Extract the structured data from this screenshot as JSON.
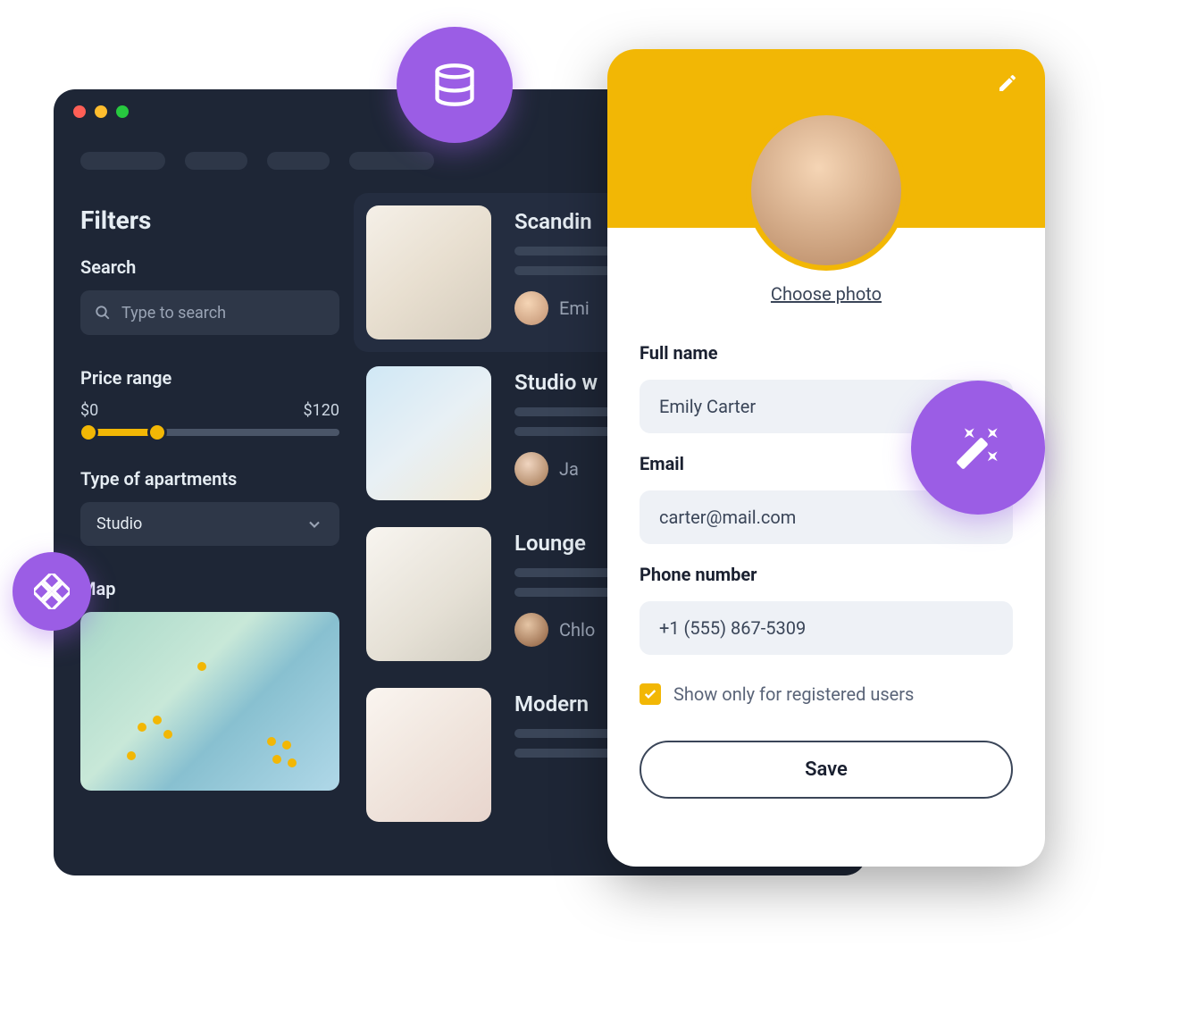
{
  "filters": {
    "heading": "Filters",
    "search_label": "Search",
    "search_placeholder": "Type to search",
    "price_label": "Price range",
    "price_min": "$0",
    "price_max": "$120",
    "type_label": "Type of apartments",
    "type_value": "Studio",
    "map_label": "Map"
  },
  "listings": [
    {
      "title": "Scandin",
      "owner": "Emi"
    },
    {
      "title": "Studio w",
      "owner": "Ja"
    },
    {
      "title": "Lounge",
      "owner": "Chlo"
    },
    {
      "title": "Modern",
      "owner": ""
    }
  ],
  "profile": {
    "choose_photo": "Choose photo",
    "full_name_label": "Full name",
    "full_name_value": "Emily Carter",
    "email_label": "Email",
    "email_value": "carter@mail.com",
    "phone_label": "Phone number",
    "phone_value": "+1 (555) 867-5309",
    "checkbox_label": "Show only for registered users",
    "save_label": "Save"
  },
  "bubbles": {
    "db": "database-icon",
    "grid": "grid-icon",
    "wand": "magic-wand-icon"
  }
}
